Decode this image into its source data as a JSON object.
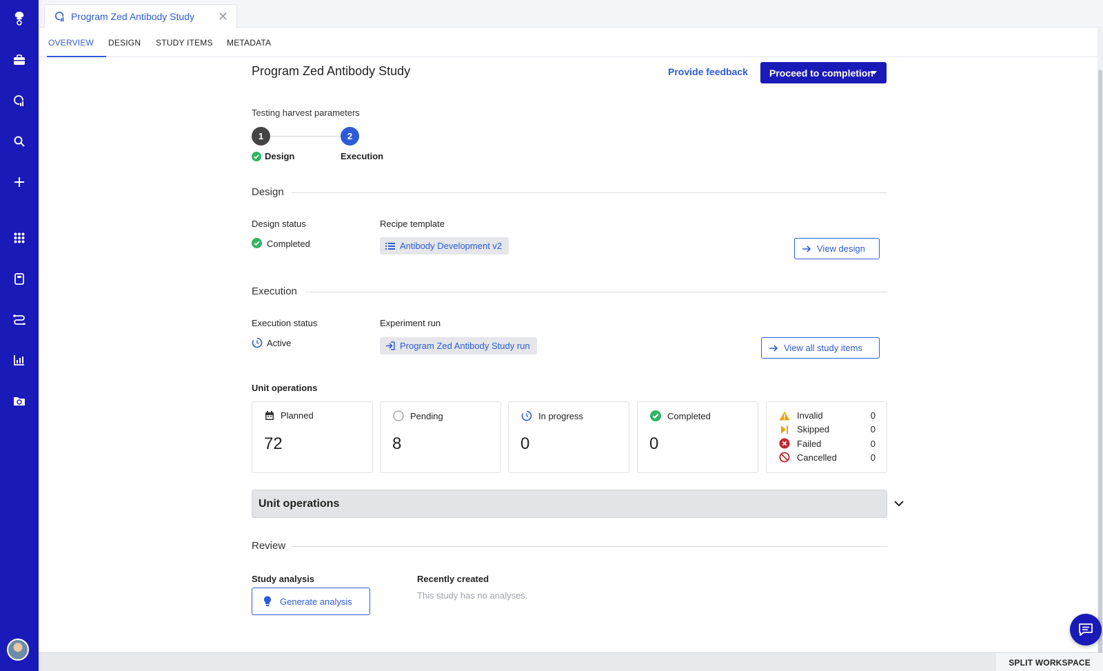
{
  "tab": {
    "title": "Program Zed Antibody Study"
  },
  "subnav": {
    "overview": "OVERVIEW",
    "design": "DESIGN",
    "study_items": "STUDY ITEMS",
    "metadata": "METADATA"
  },
  "header": {
    "title": "Program Zed Antibody Study",
    "feedback": "Provide feedback",
    "proceed": "Proceed to completion"
  },
  "stepper": {
    "caption": "Testing harvest parameters",
    "steps": [
      {
        "num": "1",
        "label": "Design"
      },
      {
        "num": "2",
        "label": "Execution"
      }
    ]
  },
  "design": {
    "heading": "Design",
    "status_label": "Design status",
    "status_value": "Completed",
    "template_label": "Recipe template",
    "template_value": "Antibody Development v2",
    "view_button": "View design"
  },
  "execution": {
    "heading": "Execution",
    "status_label": "Execution status",
    "status_value": "Active",
    "run_label": "Experiment run",
    "run_value": "Program Zed Antibody Study run",
    "view_button": "View all study items"
  },
  "unit_ops": {
    "heading": "Unit operations",
    "cards": [
      {
        "label": "Planned",
        "value": "72",
        "icon": "calendar-icon"
      },
      {
        "label": "Pending",
        "value": "8",
        "icon": "empty-circle-icon"
      },
      {
        "label": "In progress",
        "value": "0",
        "icon": "progress-icon"
      },
      {
        "label": "Completed",
        "value": "0",
        "icon": "check-circle-icon"
      }
    ],
    "other": [
      {
        "label": "Invalid",
        "value": "0",
        "icon": "warning-icon"
      },
      {
        "label": "Skipped",
        "value": "0",
        "icon": "skip-icon"
      },
      {
        "label": "Failed",
        "value": "0",
        "icon": "error-circle-icon"
      },
      {
        "label": "Cancelled",
        "value": "0",
        "icon": "cancel-icon"
      }
    ],
    "accordion": "Unit operations"
  },
  "review": {
    "heading": "Review",
    "analysis_label": "Study analysis",
    "generate_button": "Generate analysis",
    "recent_label": "Recently created",
    "recent_empty": "This study has no analyses."
  },
  "footer": {
    "split": "SPLIT WORKSPACE"
  },
  "colors": {
    "brand": "#1a1ab8",
    "link": "#2d5bd8",
    "success": "#2fb463",
    "warning": "#e8a317",
    "danger": "#c0262d"
  }
}
